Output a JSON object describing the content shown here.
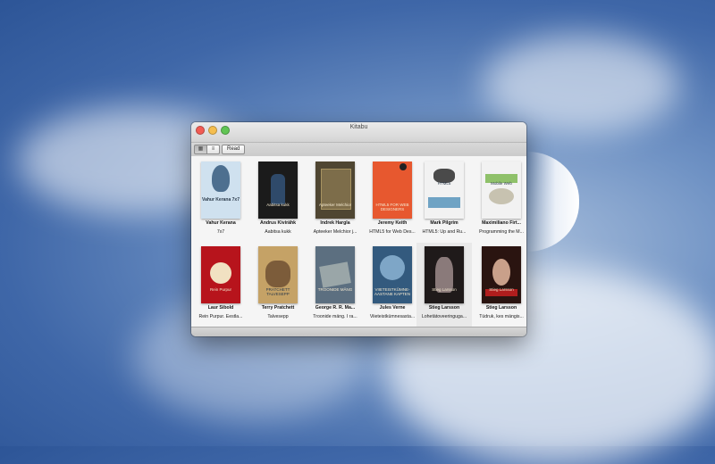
{
  "window": {
    "title": "Kitabu"
  },
  "toolbar": {
    "read_label": "Read"
  },
  "books": [
    {
      "author": "Vahur Kerana",
      "title": "7x7",
      "cover_text": "Vahur Kerana 7x7",
      "cover_color": "#cfe1ef"
    },
    {
      "author": "Andrus Kivirähk",
      "title": "Aabitsa kukk",
      "cover_text": "Aabitsa kukk",
      "cover_color": "#1b1b1b"
    },
    {
      "author": "Indrek Hargla",
      "title": "Apteeker Melchior j...",
      "cover_text": "Apteeker Melchior",
      "cover_color": "#4f4632"
    },
    {
      "author": "Jeremy Keith",
      "title": "HTML5 for Web Des...",
      "cover_text": "HTML5 FOR WEB DESIGNERS",
      "cover_color": "#e7582f"
    },
    {
      "author": "Mark Pilgrim",
      "title": "HTML5: Up and Ru...",
      "cover_text": "HTML5",
      "cover_color": "#f2f2f2"
    },
    {
      "author": "Maximiliano Firt...",
      "title": "Programming the M...",
      "cover_text": "Mobile Web",
      "cover_color": "#f2f2f2"
    },
    {
      "author": "Laur Sibold",
      "title": "Rein Purpur. Eestla...",
      "cover_text": "Rein Purpur",
      "cover_color": "#b7141c"
    },
    {
      "author": "Terry Pratchett",
      "title": "Talvesepp",
      "cover_text": "PRATCHETT TALVESEPP",
      "cover_color": "#c5a266"
    },
    {
      "author": "George R. R. Ma...",
      "title": "Troonide mäng. I ra...",
      "cover_text": "TROONIDE MÄNG",
      "cover_color": "#5c6f80"
    },
    {
      "author": "Jules Verne",
      "title": "Viieteistkümnesasta...",
      "cover_text": "VIIETEISTKÜMNE-AASTANE KAPTEN",
      "cover_color": "#335a7e"
    },
    {
      "author": "Stieg Larsson",
      "title": "Lohetätoveeringuga...",
      "cover_text": "Stieg Larsson",
      "cover_color": "#1f1a1a"
    },
    {
      "author": "Stieg Larsson",
      "title": "Tüdruk, kes mängis...",
      "cover_text": "Stieg Larsson",
      "cover_color": "#2a1410"
    }
  ]
}
